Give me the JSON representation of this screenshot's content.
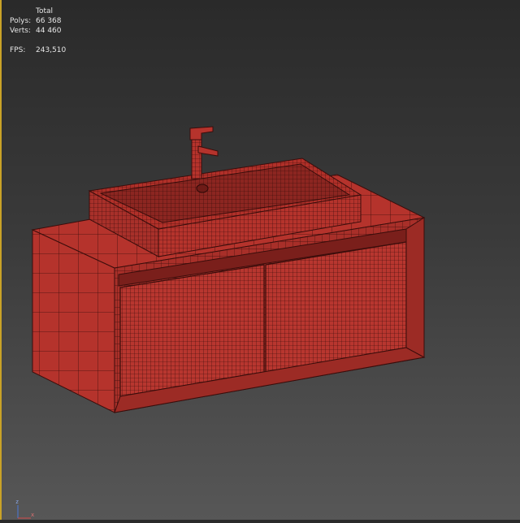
{
  "viewport": {
    "stats": {
      "header": "Total",
      "polys_label": "Polys:",
      "polys_value": "66 368",
      "verts_label": "Verts:",
      "verts_value": "44 460",
      "fps_label": "FPS:",
      "fps_value": "243,510"
    },
    "axis_gizmo": {
      "z_label": "z",
      "x_label": "x"
    },
    "colors": {
      "border": "#c9a227",
      "mesh_fill": "#b5332c",
      "mesh_wire": "#3a0d0b",
      "text": "#e6e6e6"
    }
  }
}
